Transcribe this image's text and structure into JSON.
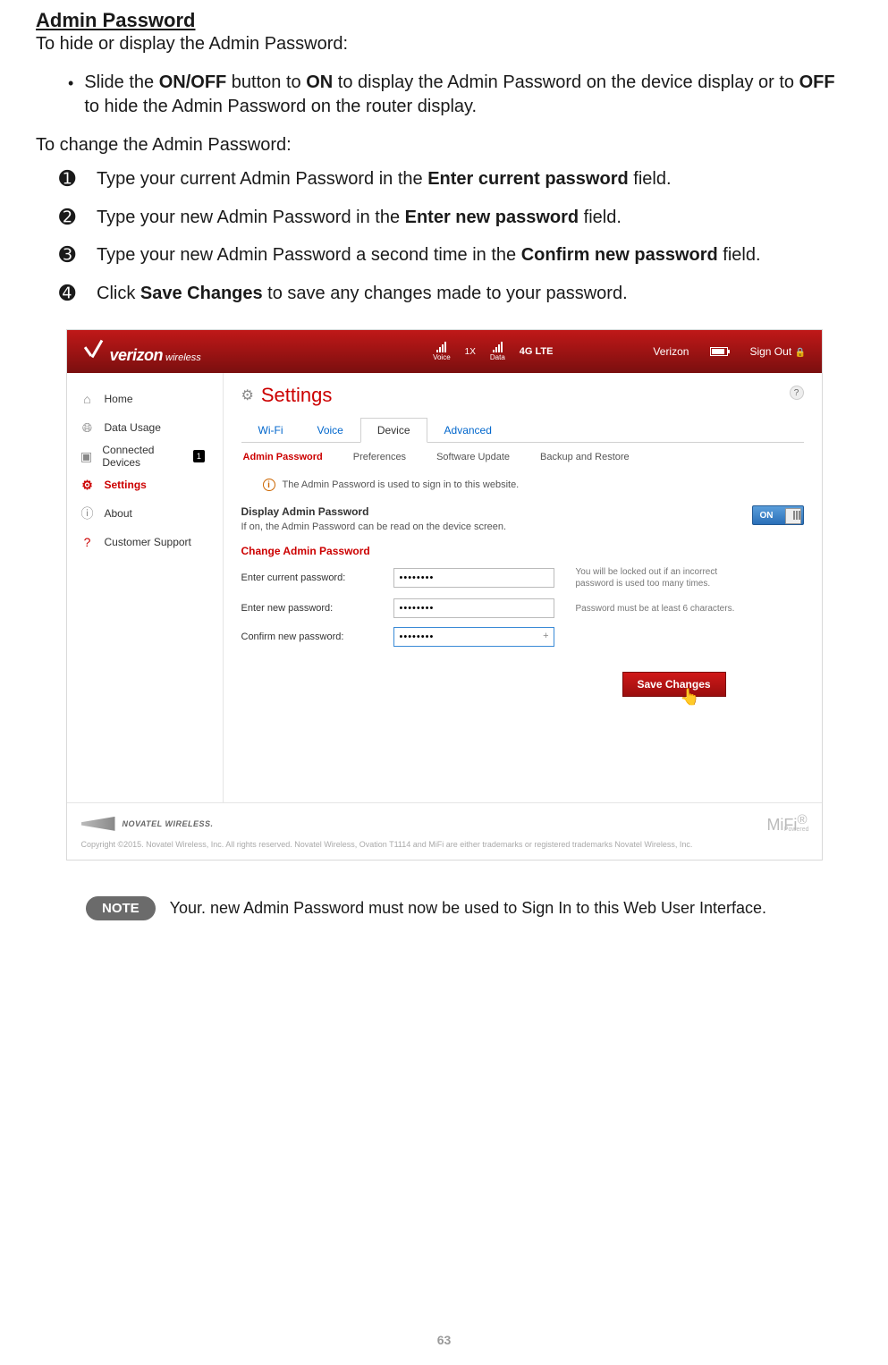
{
  "doc": {
    "title": "Admin Password",
    "intro1": "To hide or display the Admin Password:",
    "bullet_prefix": "Slide the ",
    "bullet_b1": "ON/OFF",
    "bullet_mid1": " button to ",
    "bullet_b2": "ON",
    "bullet_mid2": " to display the Admin Password on the device display or to ",
    "bullet_b3": "OFF",
    "bullet_suffix": " to hide the Admin Password on the router display.",
    "intro2": "To change the Admin Password:",
    "step1_a": "Type your current Admin Password in the ",
    "step1_b": "Enter current password",
    "step1_c": " field.",
    "step2_a": "Type your new Admin Password in the ",
    "step2_b": "Enter new password",
    "step2_c": " field.",
    "step3_a": "Type your new Admin Password a second time in the ",
    "step3_b": "Confirm new password",
    "step3_c": " field.",
    "step4_a": "Click ",
    "step4_b": "Save Changes",
    "step4_c": " to save any changes made to your password.",
    "note_label": "NOTE",
    "note_text": "Your. new Admin Password must now be used to Sign In to this Web User Interface.",
    "page_number": "63",
    "sym": {
      "n1": "➊",
      "n2": "➋",
      "n3": "➌",
      "n4": "➍",
      "bullet": "•"
    }
  },
  "shot": {
    "brand_main": "verizon",
    "brand_sub": "wireless",
    "hdr_voice": "Voice",
    "hdr_1x": "1X",
    "hdr_data": "Data",
    "hdr_4g": "4G LTE",
    "hdr_carrier": "Verizon",
    "hdr_signout": "Sign Out",
    "sidebar": [
      {
        "label": "Home"
      },
      {
        "label": "Data Usage"
      },
      {
        "label": "Connected Devices",
        "badge": "1"
      },
      {
        "label": "Settings"
      },
      {
        "label": "About"
      },
      {
        "label": "Customer Support"
      }
    ],
    "page_title": "Settings",
    "tabs": [
      "Wi-Fi",
      "Voice",
      "Device",
      "Advanced"
    ],
    "subtabs": [
      "Admin Password",
      "Preferences",
      "Software Update",
      "Backup and Restore"
    ],
    "info_text": "The Admin Password is used to sign in to this website.",
    "display_h": "Display Admin Password",
    "display_sub": "If on, the Admin Password can be read on the device screen.",
    "toggle": "ON",
    "change_h": "Change Admin Password",
    "field1_label": "Enter current password:",
    "field1_value": "••••••••",
    "field1_hint": "You will be locked out if an incorrect password is used too many times.",
    "field2_label": "Enter new password:",
    "field2_value": "••••••••",
    "field2_hint": "Password must be at least 6 characters.",
    "field3_label": "Confirm new password:",
    "field3_value": "••••••••",
    "save_label": "Save Changes",
    "footer_brand": "NOVATEL WIRELESS.",
    "mifi": "MiFi",
    "mifi_sub": "Powered",
    "copyright": "Copyright ©2015. Novatel Wireless, Inc. All rights reserved. Novatel Wireless, Ovation T1114 and MiFi are either trademarks or registered trademarks Novatel Wireless, Inc."
  }
}
